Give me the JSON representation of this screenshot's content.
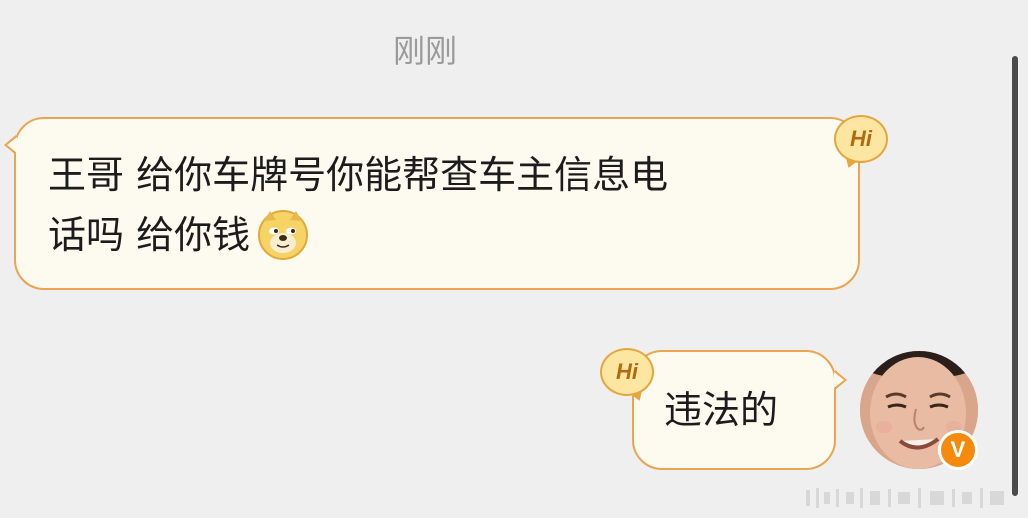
{
  "chat": {
    "timestamp": "刚刚",
    "messages": [
      {
        "side": "incoming",
        "line1": "王哥 给你车牌号你能帮查车主信息电",
        "line2": "话吗 给你钱",
        "emoji": "doge-emoji",
        "badge": "Hi"
      },
      {
        "side": "outgoing",
        "text": "违法的",
        "badge": "Hi"
      }
    ]
  },
  "avatar": {
    "verified_label": "V",
    "verified_color": "#f58a0c"
  },
  "colors": {
    "background": "#efefef",
    "bubble_fill": "#fdfaf0",
    "bubble_border": "#e9a550",
    "timestamp": "#9a9a9a"
  }
}
